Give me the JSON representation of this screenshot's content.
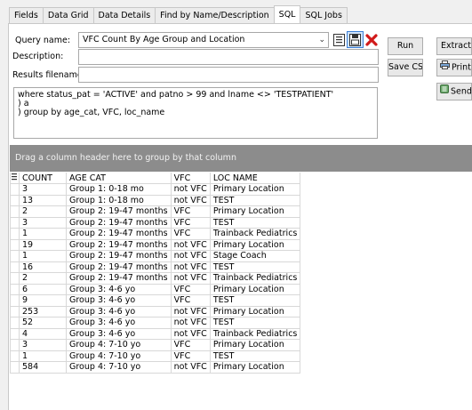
{
  "tabs": [
    "Fields",
    "Data Grid",
    "Data Details",
    "Find by Name/Description",
    "SQL",
    "SQL Jobs"
  ],
  "active_tab": "SQL",
  "form": {
    "query_name_label": "Query name:",
    "query_name_value": "VFC Count By Age Group and Location",
    "description_label": "Description:",
    "description_value": "",
    "results_label": "Results filename:",
    "results_value": ""
  },
  "buttons": {
    "run": "Run",
    "extract": "Extract",
    "save_csv": "Save CSV",
    "print": "Print",
    "send": "Send"
  },
  "sql_text": "where status_pat = 'ACTIVE' and patno > 99 and lname <> 'TESTPATIENT'\n) a\n) group by age_cat, VFC, loc_name",
  "grid": {
    "group_hint": "Drag a column header here to group by that column",
    "columns": [
      "COUNT",
      "AGE CAT",
      "VFC",
      "LOC NAME"
    ],
    "rows": [
      [
        "3",
        "Group 1:  0-18 mo",
        "not VFC",
        "Primary Location"
      ],
      [
        "13",
        "Group 1:  0-18 mo",
        "not VFC",
        "TEST"
      ],
      [
        "2",
        "Group 2: 19-47 months",
        "VFC",
        "Primary Location"
      ],
      [
        "3",
        "Group 2: 19-47 months",
        "VFC",
        "TEST"
      ],
      [
        "1",
        "Group 2: 19-47 months",
        "VFC",
        "Trainback Pediatrics"
      ],
      [
        "19",
        "Group 2: 19-47 months",
        "not VFC",
        "Primary Location"
      ],
      [
        "1",
        "Group 2: 19-47 months",
        "not VFC",
        "Stage Coach"
      ],
      [
        "16",
        "Group 2: 19-47 months",
        "not VFC",
        "TEST"
      ],
      [
        "2",
        "Group 2: 19-47 months",
        "not VFC",
        "Trainback Pediatrics"
      ],
      [
        "6",
        "Group 3:  4-6 yo",
        "VFC",
        "Primary Location"
      ],
      [
        "9",
        "Group 3:  4-6 yo",
        "VFC",
        "TEST"
      ],
      [
        "253",
        "Group 3:  4-6 yo",
        "not VFC",
        "Primary Location"
      ],
      [
        "52",
        "Group 3:  4-6 yo",
        "not VFC",
        "TEST"
      ],
      [
        "4",
        "Group 3:  4-6 yo",
        "not VFC",
        "Trainback Pediatrics"
      ],
      [
        "3",
        "Group 4:  7-10 yo",
        "VFC",
        "Primary Location"
      ],
      [
        "1",
        "Group 4:  7-10 yo",
        "VFC",
        "TEST"
      ],
      [
        "584",
        "Group 4:  7-10 yo",
        "not VFC",
        "Primary Location"
      ]
    ]
  },
  "icons": {
    "combo": "chevron-down-icon",
    "save": "save-icon",
    "save_as": "save-as-icon",
    "delete": "delete-icon",
    "print": "printer-icon",
    "send": "send-icon"
  },
  "colors": {
    "delete": "#d11a1a",
    "group_bar": "#8c8c8c",
    "selection_border": "#3c7fd6"
  }
}
